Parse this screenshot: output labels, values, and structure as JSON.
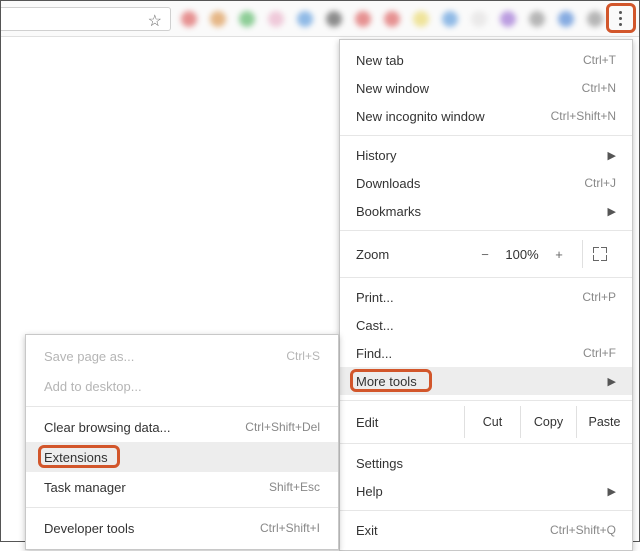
{
  "menu": {
    "new_tab": {
      "label": "New tab",
      "shortcut": "Ctrl+T"
    },
    "new_window": {
      "label": "New window",
      "shortcut": "Ctrl+N"
    },
    "new_incognito": {
      "label": "New incognito window",
      "shortcut": "Ctrl+Shift+N"
    },
    "history": {
      "label": "History"
    },
    "downloads": {
      "label": "Downloads",
      "shortcut": "Ctrl+J"
    },
    "bookmarks": {
      "label": "Bookmarks"
    },
    "zoom": {
      "label": "Zoom",
      "minus": "−",
      "value": "100%",
      "plus": "+"
    },
    "print": {
      "label": "Print...",
      "shortcut": "Ctrl+P"
    },
    "cast": {
      "label": "Cast..."
    },
    "find": {
      "label": "Find...",
      "shortcut": "Ctrl+F"
    },
    "more_tools": {
      "label": "More tools"
    },
    "edit": {
      "label": "Edit",
      "cut": "Cut",
      "copy": "Copy",
      "paste": "Paste"
    },
    "settings": {
      "label": "Settings"
    },
    "help": {
      "label": "Help"
    },
    "exit": {
      "label": "Exit",
      "shortcut": "Ctrl+Shift+Q"
    }
  },
  "submenu": {
    "save_page": {
      "label": "Save page as...",
      "shortcut": "Ctrl+S"
    },
    "add_desktop": {
      "label": "Add to desktop..."
    },
    "clear_data": {
      "label": "Clear browsing data...",
      "shortcut": "Ctrl+Shift+Del"
    },
    "extensions": {
      "label": "Extensions"
    },
    "task_manager": {
      "label": "Task manager",
      "shortcut": "Shift+Esc"
    },
    "dev_tools": {
      "label": "Developer tools",
      "shortcut": "Ctrl+Shift+I"
    }
  },
  "ext_colors": [
    "#d94c4c",
    "#d88a3a",
    "#46b055",
    "#e8a9c4",
    "#4a90d9",
    "#444",
    "#d94c4c",
    "#d94c4c",
    "#e8d55b",
    "#4a90d9",
    "#e0dede",
    "#915fcf",
    "#888",
    "#3a78d1",
    "#888"
  ]
}
